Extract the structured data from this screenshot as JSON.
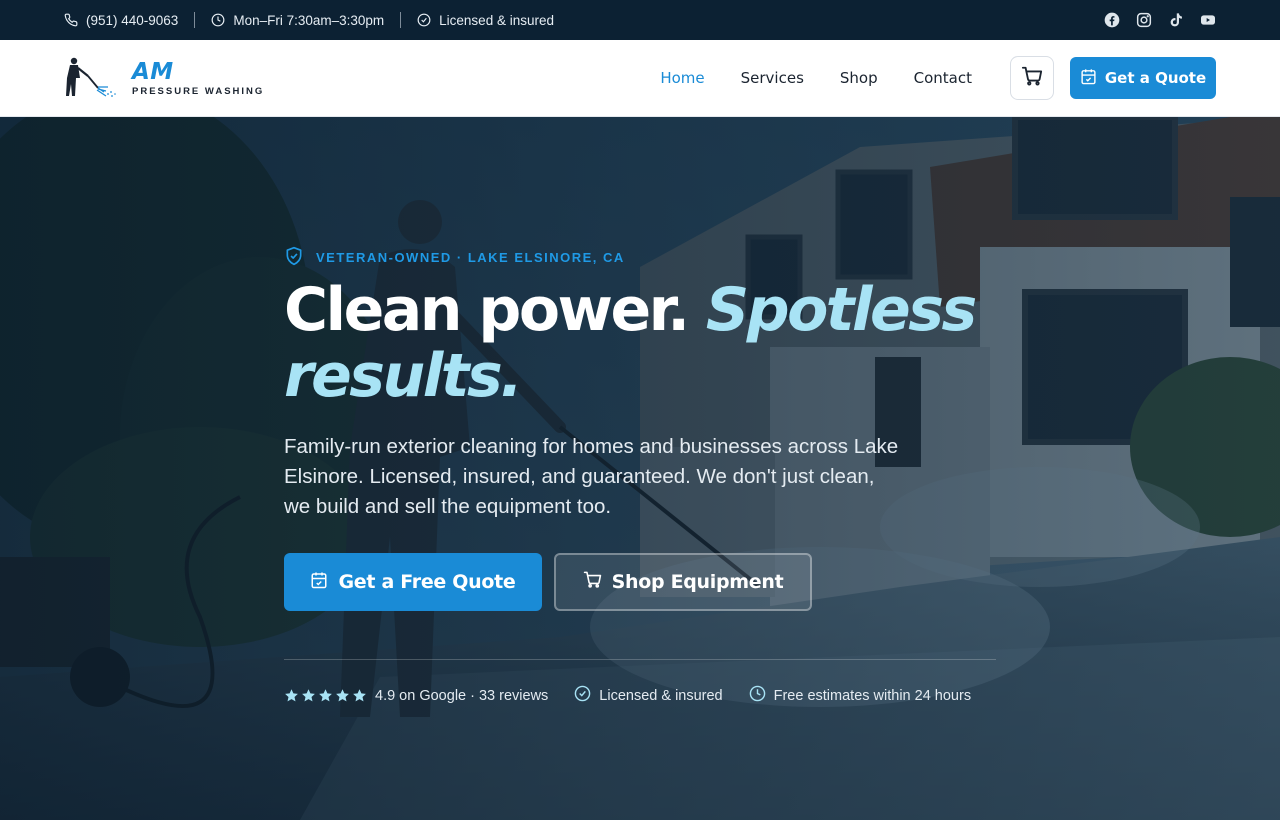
{
  "topbar": {
    "phone": "(951) 440-9063",
    "hours": "Mon–Fri 7:30am–3:30pm",
    "licensed": "Licensed & insured",
    "social": [
      "facebook-icon",
      "instagram-icon",
      "tiktok-icon",
      "youtube-icon"
    ]
  },
  "nav": {
    "brand": "AM",
    "tagline": "PRESSURE WASHING",
    "links": [
      "Home",
      "Services",
      "Shop",
      "Contact"
    ],
    "active": "Home",
    "quote_label": "Get a Quote"
  },
  "hero": {
    "eyebrow": "VETERAN-OWNED · LAKE ELSINORE, CA",
    "headline_1": "Clean power. ",
    "headline_accent": "Spotless results.",
    "subtext": "Family-run exterior cleaning for homes and businesses across Lake Elsinore. Licensed, insured, and guaranteed. We don't just clean, we build and sell the equipment too.",
    "cta_primary": "Get a Free Quote",
    "cta_secondary": "Shop Equipment",
    "rating": "4.9 on Google · 33 reviews",
    "stars": 5,
    "trust_licensed": "Licensed & insured",
    "trust_estimates": "Free estimates within 24 hours"
  },
  "colors": {
    "accent": "#1a8bd6",
    "accent_light": "#a8e3f5",
    "topbar": "#0c2133"
  }
}
